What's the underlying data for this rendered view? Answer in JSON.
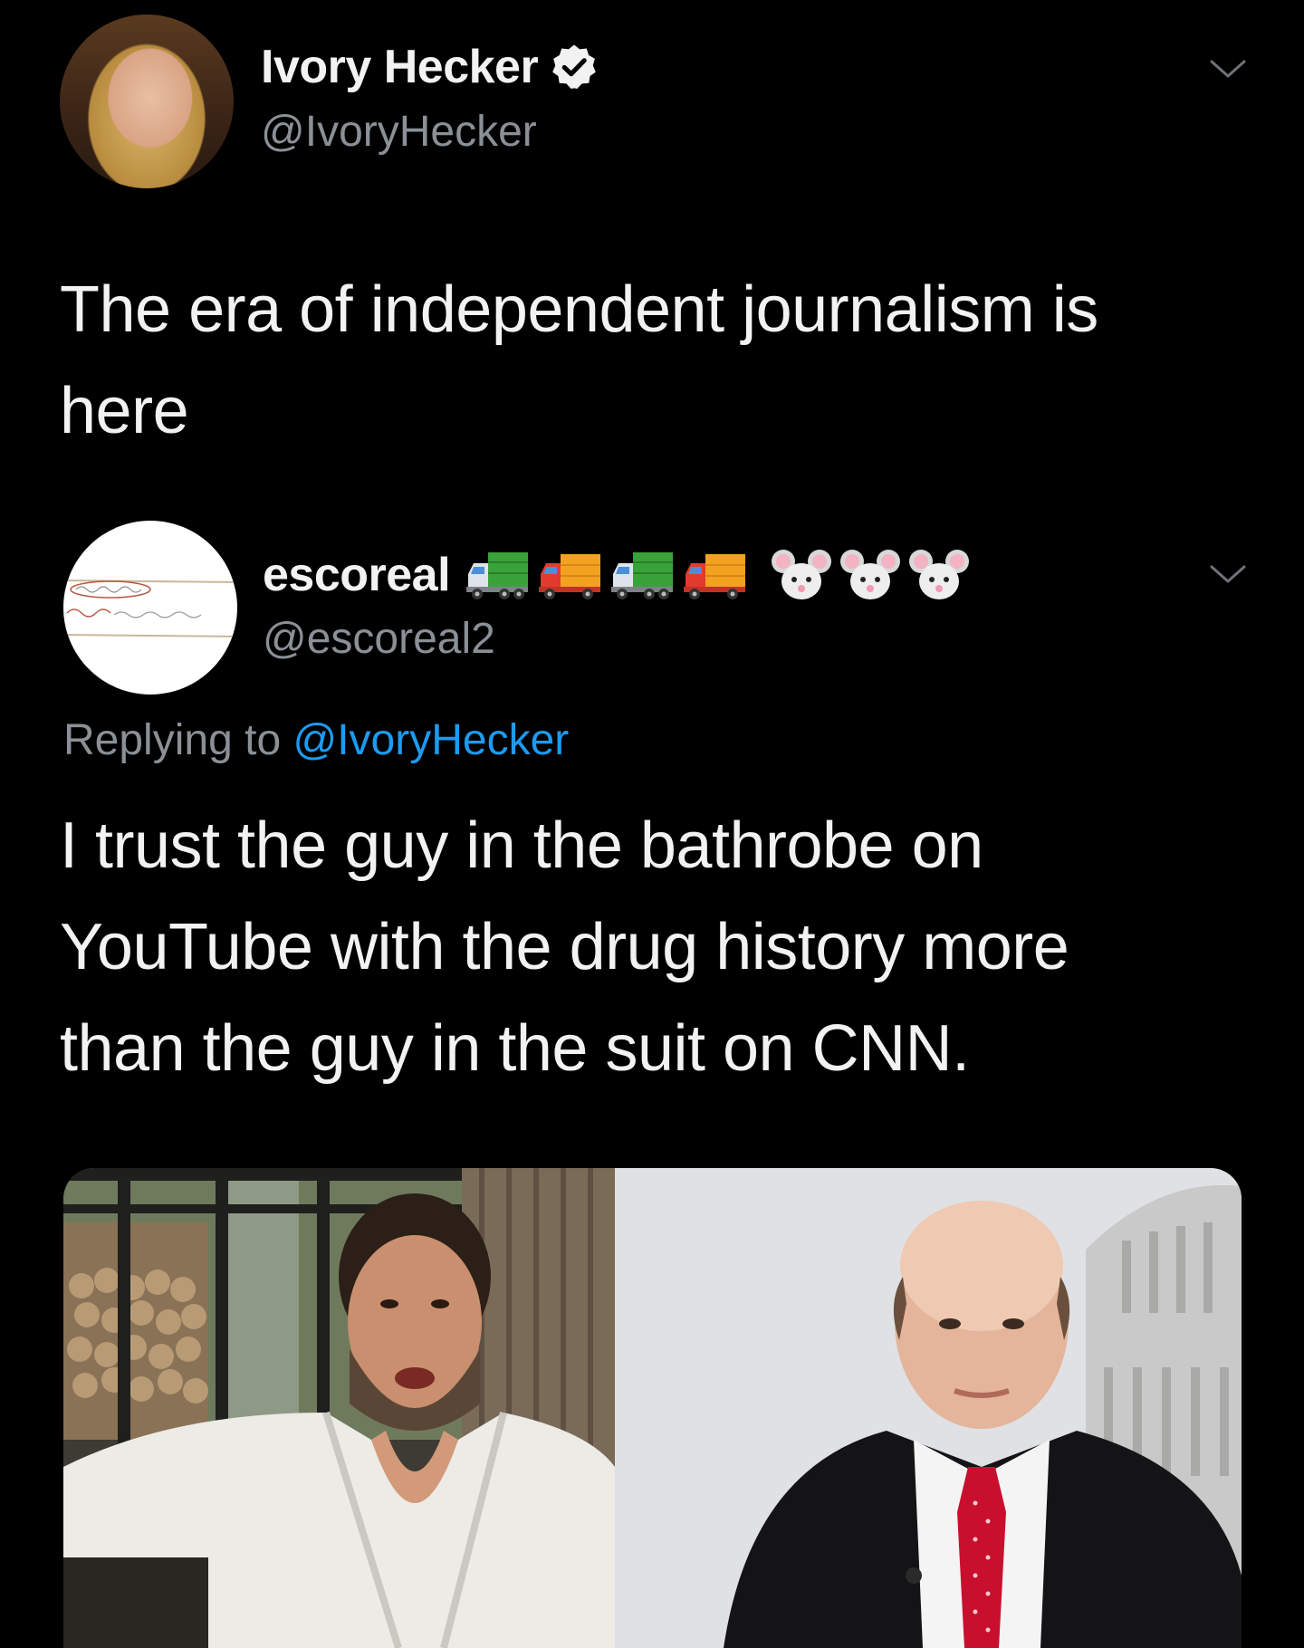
{
  "tweet1": {
    "display_name": "Ivory Hecker",
    "handle": "@IvoryHecker",
    "verified": true,
    "text_line1": "The era of independent journalism is",
    "text_line2": "here",
    "icons": {
      "verified": "verified-badge-icon",
      "more": "chevron-down-icon"
    }
  },
  "tweet2": {
    "display_name": "escoreal",
    "name_emojis": [
      "delivery-truck-green-icon",
      "delivery-truck-orange-icon",
      "delivery-truck-green-icon",
      "delivery-truck-orange-icon",
      "mouse-face-icon",
      "mouse-face-icon",
      "mouse-face-icon"
    ],
    "handle": "@escoreal2",
    "replying_prefix": "Replying to ",
    "replying_mention": "@IvoryHecker",
    "text_line1": "I trust the guy in the bathrobe on",
    "text_line2": "YouTube with the drug history more",
    "text_line3": "than the guy in the suit on CNN.",
    "icons": {
      "more": "chevron-down-icon"
    }
  },
  "colors": {
    "background": "#000000",
    "primary_text": "#f2f2f2",
    "secondary_text": "#8b9097",
    "link": "#1d9bf0"
  }
}
